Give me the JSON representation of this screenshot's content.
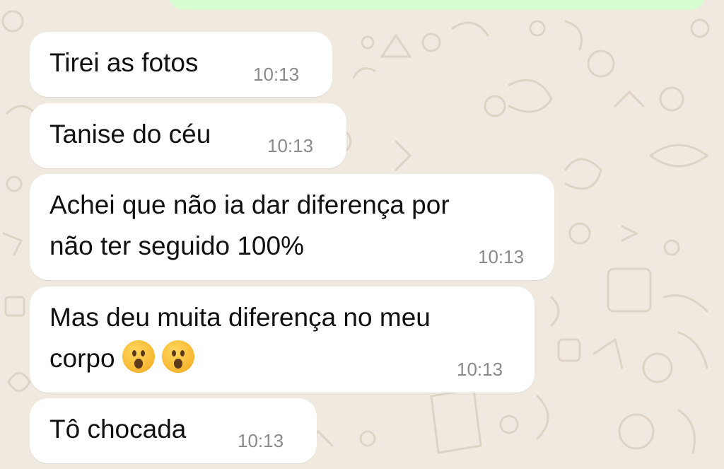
{
  "chat": {
    "messages": [
      {
        "text": "Tirei as fotos",
        "time": "10:13"
      },
      {
        "text": "Tanise do céu",
        "time": "10:13"
      },
      {
        "line1": "Achei que não ia dar diferença por",
        "line2": "não ter seguido 100%",
        "time": "10:13"
      },
      {
        "line1": "Mas deu muita diferença no meu",
        "line2": "corpo",
        "emoji": "astonished-face",
        "time": "10:13"
      },
      {
        "text": "Tô chocada",
        "time": "10:13"
      }
    ]
  },
  "colors": {
    "background": "#efe9e0",
    "incoming_bubble": "#ffffff",
    "outgoing_bubble": "#d9fdd3",
    "timestamp": "#8a8a8a"
  }
}
